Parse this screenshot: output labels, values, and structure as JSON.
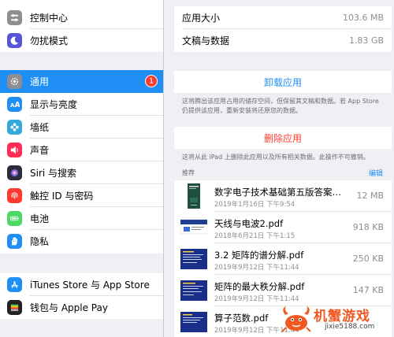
{
  "sidebar": {
    "group1": [
      {
        "label": "控制中心",
        "icon": "control-center-icon",
        "color": "#8e8e93"
      },
      {
        "label": "勿扰模式",
        "icon": "moon-icon",
        "color": "#5856d6"
      }
    ],
    "group2": [
      {
        "label": "通用",
        "icon": "gear-icon",
        "color": "#8e8e93",
        "badge": "1",
        "selected": true
      },
      {
        "label": "显示与亮度",
        "icon": "text-size-icon",
        "color": "#1f8ff5"
      },
      {
        "label": "墙纸",
        "icon": "wallpaper-flower-icon",
        "color": "#34aadc"
      },
      {
        "label": "声音",
        "icon": "speaker-icon",
        "color": "#ff2d55"
      },
      {
        "label": "Siri 与搜索",
        "icon": "siri-icon",
        "color": "#2b2b3a"
      },
      {
        "label": "触控 ID 与密码",
        "icon": "fingerprint-icon",
        "color": "#ff3b30"
      },
      {
        "label": "电池",
        "icon": "battery-icon",
        "color": "#4cd964"
      },
      {
        "label": "隐私",
        "icon": "hand-icon",
        "color": "#1f8ff5"
      }
    ],
    "group3": [
      {
        "label": "iTunes Store 与 App Store",
        "icon": "app-store-icon",
        "color": "#1f8ff5"
      },
      {
        "label": "钱包与 Apple Pay",
        "icon": "wallet-icon",
        "color": "#222222"
      }
    ]
  },
  "detail": {
    "app_size_label": "应用大小",
    "app_size_value": "103.6 MB",
    "docs_label": "文稿与数据",
    "docs_value": "1.83 GB",
    "offload_label": "卸载应用",
    "offload_note": "这将腾出该应用占用的储存空间，但保留其文稿和数据。若 App Store 仍提供该应用，重新安装将还原您的数据。",
    "delete_label": "删除应用",
    "delete_note": "这将从此 iPad 上删除此应用以及所有相关数据。此操作不可撤销。",
    "recommend_label": "推荐",
    "edit_label": "编辑",
    "documents": [
      {
        "title": "数字电子技术基础第五版答案全...",
        "date": "2019年1月16日 下午9:54",
        "size": "12 MB",
        "thumb": "book"
      },
      {
        "title": "天线与电波2.pdf",
        "date": "2018年6月21日 下午1:15",
        "size": "918 KB",
        "thumb": "slide-wide"
      },
      {
        "title": "3.2 矩阵的谱分解.pdf",
        "date": "2019年9月12日 下午11:44",
        "size": "250 KB",
        "thumb": "slide"
      },
      {
        "title": "矩阵的最大秩分解.pdf",
        "date": "2019年9月12日 下午11:44",
        "size": "147 KB",
        "thumb": "slide"
      },
      {
        "title": "算子范数.pdf",
        "date": "2019年9月12日 下午11:44",
        "size": "",
        "thumb": "slide"
      }
    ]
  },
  "watermark": {
    "text": "机蟹游戏",
    "url": "jixie5188.com"
  },
  "colors": {
    "accent": "#1f8ff5",
    "destructive": "#ff3b30",
    "background": "#efeff4",
    "watermark": "#f05a22"
  }
}
